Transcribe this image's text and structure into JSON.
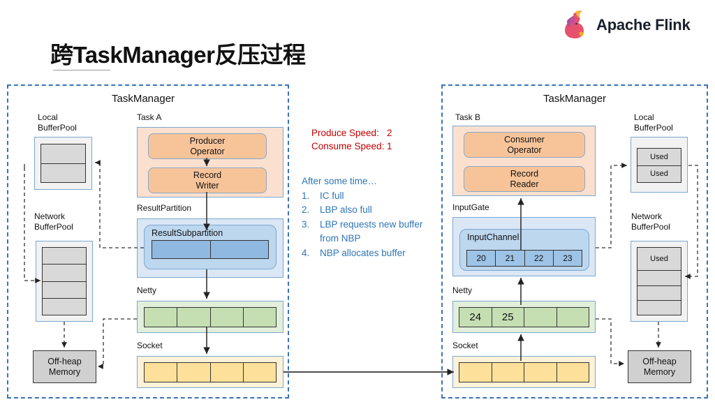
{
  "header": {
    "brand_text": "Apache Flink",
    "logo_icon": "flink-squirrel-logo",
    "title": "跨TaskManager反压过程"
  },
  "colors": {
    "dashed_border": "#3a72b8",
    "task_fill": "#fbe0cf",
    "operator_fill": "#f7c49a",
    "result_partition_fill": "#dbe7f5",
    "netty_fill": "#c5dfb3",
    "socket_fill": "#fde19a",
    "buffer_gray": "#d9d9d9",
    "speed_text": "#c00000",
    "notes_text": "#2e75b6"
  },
  "left_taskmanager": {
    "title": "TaskManager",
    "local_buffer_pool": {
      "label_line1": "Local",
      "label_line2": "BufferPool",
      "cells": [
        "",
        ""
      ]
    },
    "network_buffer_pool": {
      "label_line1": "Network",
      "label_line2": "BufferPool",
      "cells": [
        "",
        "",
        "",
        ""
      ]
    },
    "off_heap_memory": {
      "line1": "Off-heap",
      "line2": "Memory"
    },
    "task": {
      "label": "Task A",
      "operators": [
        {
          "line1": "Producer",
          "line2": "Operator"
        },
        {
          "line1": "Record",
          "line2": "Writer"
        }
      ]
    },
    "result_partition": {
      "label": "ResultPartition",
      "subpartition_title": "ResultSubpartition",
      "cells": [
        "",
        ""
      ]
    },
    "netty": {
      "label": "Netty",
      "cells": [
        "",
        "",
        "",
        ""
      ]
    },
    "socket": {
      "label": "Socket",
      "cells": [
        "",
        "",
        "",
        ""
      ]
    }
  },
  "right_taskmanager": {
    "title": "TaskManager",
    "local_buffer_pool": {
      "label_line1": "Local",
      "label_line2": "BufferPool",
      "cells": [
        "Used",
        "Used"
      ]
    },
    "network_buffer_pool": {
      "label_line1": "Network",
      "label_line2": "BufferPool",
      "cells": [
        "Used",
        "",
        "",
        ""
      ]
    },
    "off_heap_memory": {
      "line1": "Off-heap",
      "line2": "Memory"
    },
    "task": {
      "label": "Task B",
      "operators": [
        {
          "line1": "Consumer",
          "line2": "Operator"
        },
        {
          "line1": "Record",
          "line2": "Reader"
        }
      ]
    },
    "input_gate": {
      "label": "InputGate",
      "channel_title": "InputChannel",
      "cells": [
        "20",
        "21",
        "22",
        "23"
      ]
    },
    "netty": {
      "label": "Netty",
      "cells": [
        "24",
        "25",
        "",
        ""
      ]
    },
    "socket": {
      "label": "Socket",
      "cells": [
        "",
        "",
        "",
        ""
      ]
    }
  },
  "annotations": {
    "produce_speed_label": "Produce Speed:",
    "produce_speed_value": "2",
    "consume_speed_label": "Consume Speed:",
    "consume_speed_value": "1",
    "notes_heading": "After some time…",
    "notes": [
      {
        "num": "1.",
        "text": "IC full"
      },
      {
        "num": "2.",
        "text": "LBP also full"
      },
      {
        "num": "3.",
        "text": "LBP requests new buffer from NBP"
      },
      {
        "num": "4.",
        "text": "NBP allocates buffer"
      }
    ]
  }
}
